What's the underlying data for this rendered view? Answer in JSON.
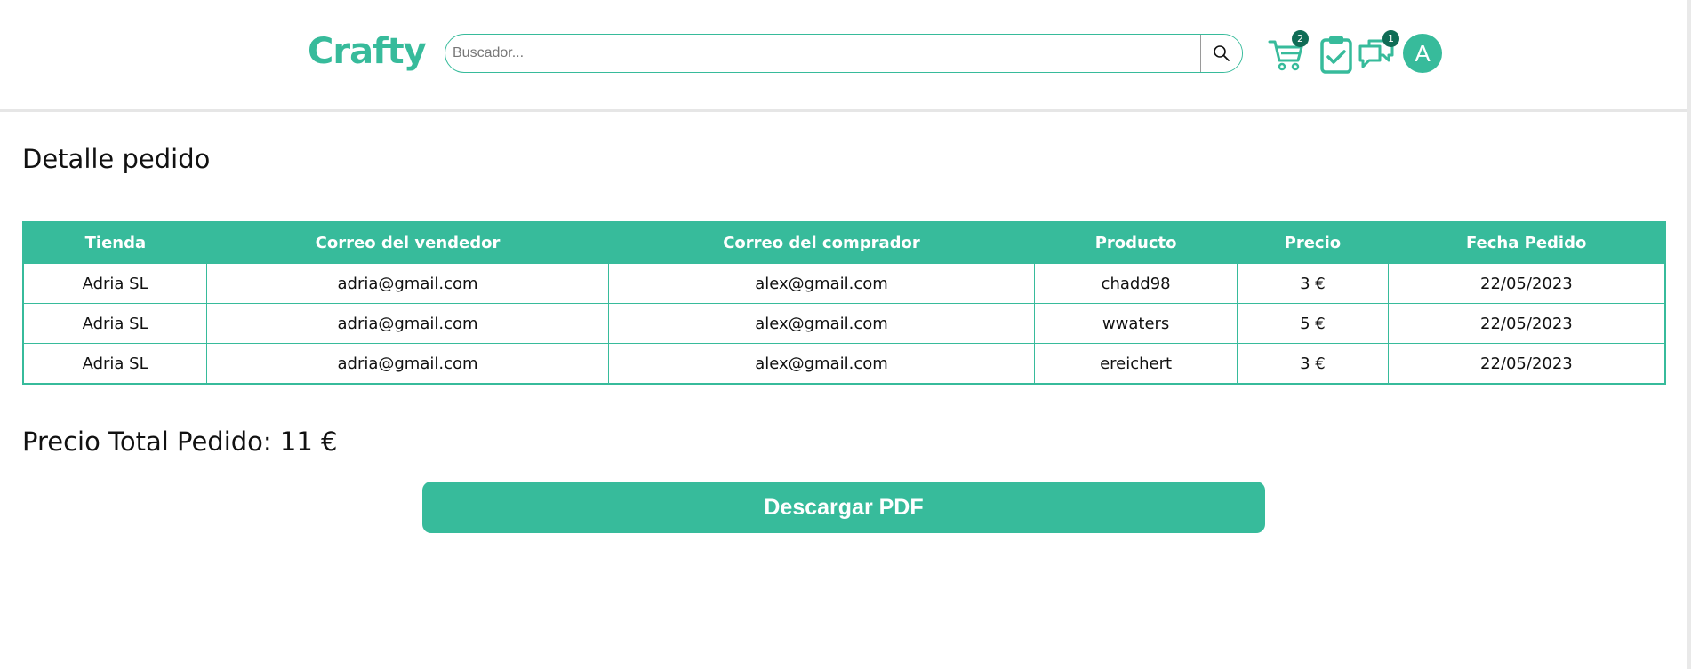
{
  "header": {
    "logo_text": "Crafty",
    "search": {
      "placeholder": "Buscador..."
    },
    "cart": {
      "badge": "2"
    },
    "orders": {
      "badge": ""
    },
    "messages": {
      "badge": "1"
    },
    "avatar_letter": "A"
  },
  "page": {
    "title": "Detalle pedido",
    "total": "Precio Total Pedido: 11 €",
    "download_button": "Descargar PDF"
  },
  "table": {
    "columns": [
      "Tienda",
      "Correo del vendedor",
      "Correo del comprador",
      "Producto",
      "Precio",
      "Fecha Pedido"
    ],
    "rows": [
      [
        "Adria SL",
        "adria@gmail.com",
        "alex@gmail.com",
        "chadd98",
        "3 €",
        "22/05/2023"
      ],
      [
        "Adria SL",
        "adria@gmail.com",
        "alex@gmail.com",
        "wwaters",
        "5 €",
        "22/05/2023"
      ],
      [
        "Adria SL",
        "adria@gmail.com",
        "alex@gmail.com",
        "ereichert",
        "3 €",
        "22/05/2023"
      ]
    ]
  },
  "colors": {
    "accent": "#37bb9b",
    "badge": "#0f6c55"
  },
  "icons": [
    "search-icon",
    "cart-icon",
    "clipboard-check-icon",
    "chat-icon"
  ]
}
